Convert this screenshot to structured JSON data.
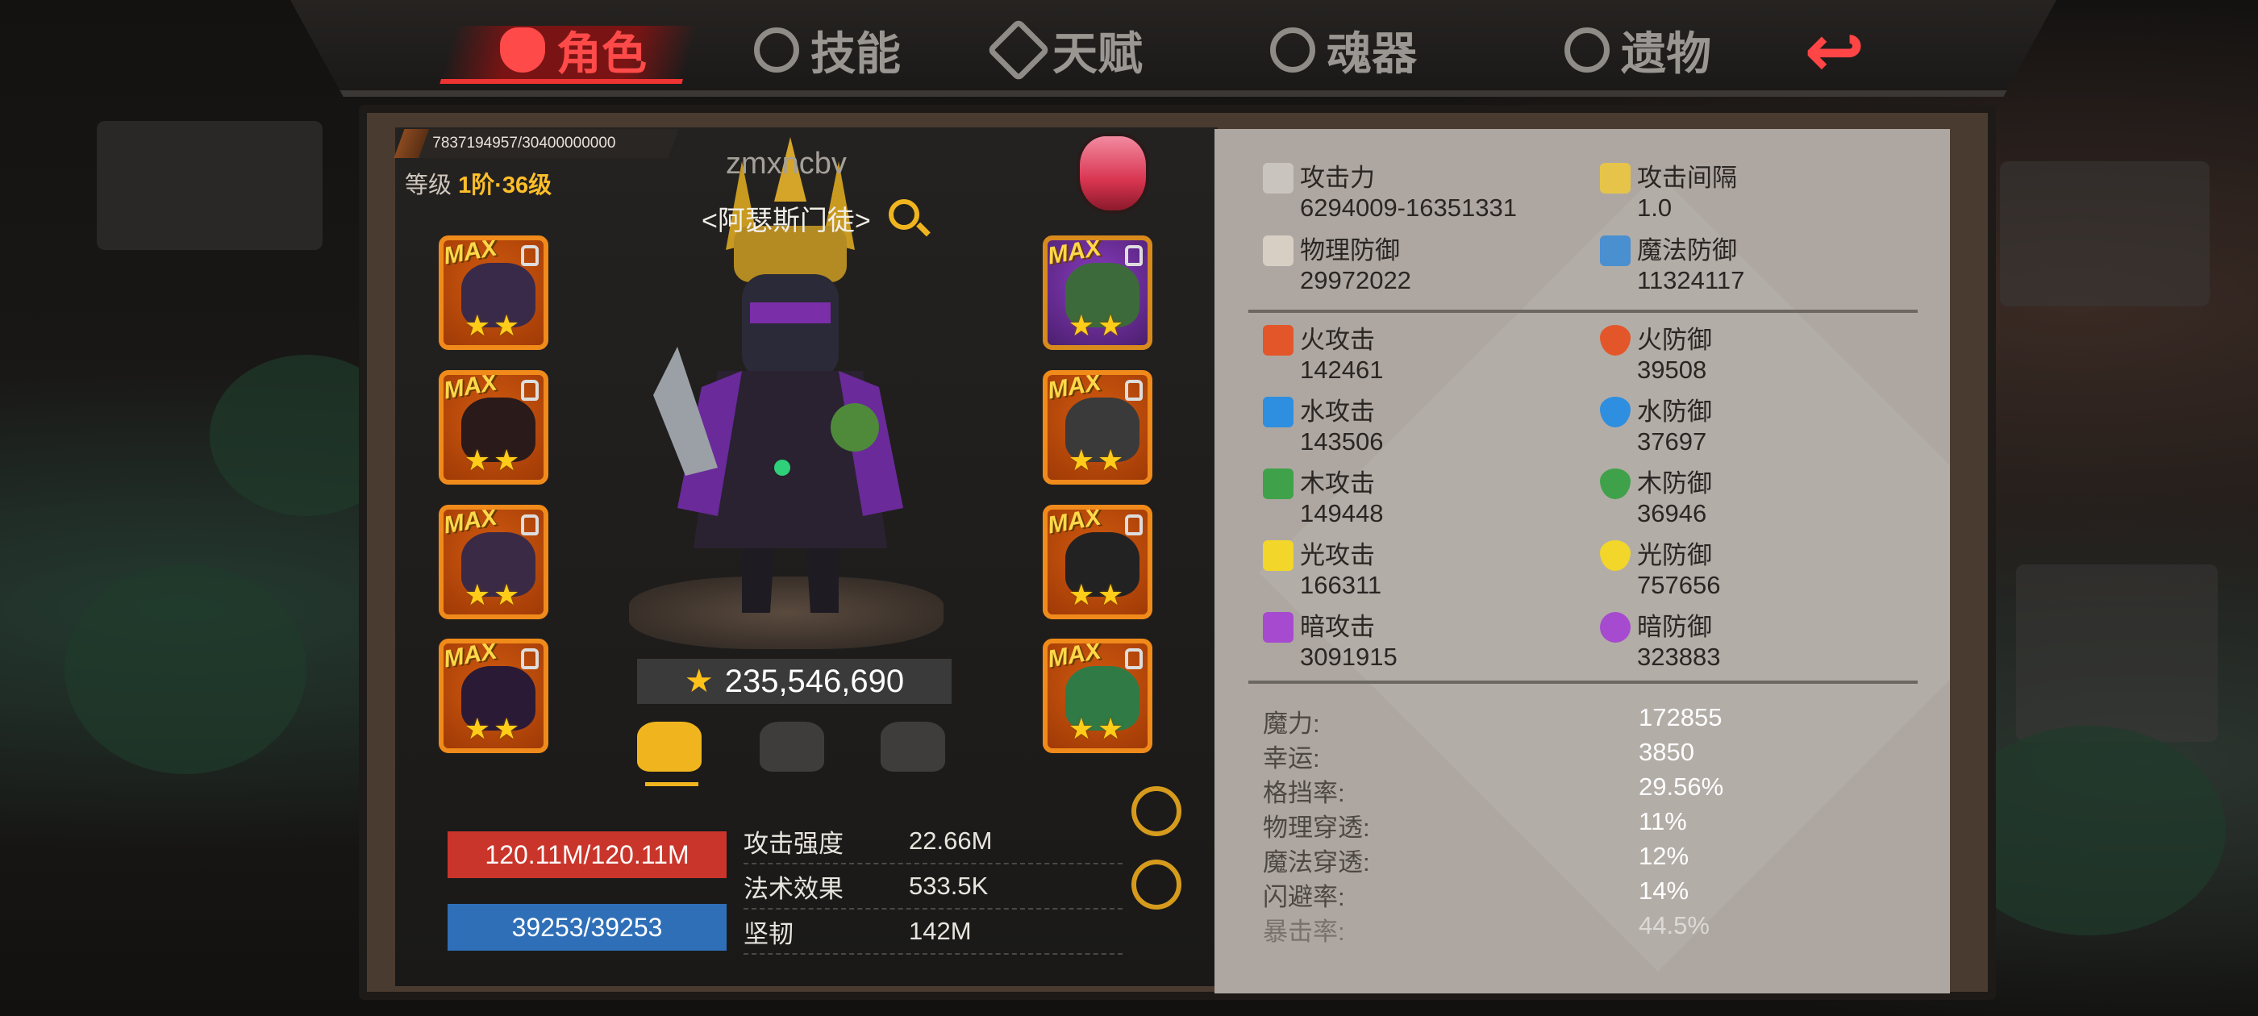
{
  "tabs": [
    {
      "label": "角色",
      "icon": "devil-icon",
      "active": true
    },
    {
      "label": "技能",
      "icon": "skill-icon",
      "active": false
    },
    {
      "label": "天赋",
      "icon": "talent-icon",
      "active": false
    },
    {
      "label": "魂器",
      "icon": "soul-icon",
      "active": false
    },
    {
      "label": "遗物",
      "icon": "relic-icon",
      "active": false
    }
  ],
  "hero": {
    "exp_text": "7837194957/30400000000",
    "exp_fraction": 0.258,
    "level_label": "等级",
    "level_value": "1阶·36级",
    "name": "zmxncbv",
    "title": "<阿瑟斯门徒>",
    "power": "235,546,690"
  },
  "gear_left": [
    {
      "max": "MAX",
      "stars": "★★",
      "color": "#3a2a4a"
    },
    {
      "max": "MAX",
      "stars": "★★",
      "color": "#2a1a1a"
    },
    {
      "max": "MAX",
      "stars": "★★",
      "color": "#3b2a45"
    },
    {
      "max": "MAX",
      "stars": "★★",
      "color": "#2a1a35"
    }
  ],
  "gear_right": [
    {
      "max": "MAX",
      "stars": "★★",
      "color": "#3d6a3a"
    },
    {
      "max": "MAX",
      "stars": "★★",
      "color": "#3a3a3a"
    },
    {
      "max": "MAX",
      "stars": "★★",
      "color": "#222222"
    },
    {
      "max": "MAX",
      "stars": "★★",
      "color": "#2f7a45"
    }
  ],
  "vitals": {
    "hp": "120.11M/120.11M",
    "mp": "39253/39253"
  },
  "sub_stats": [
    {
      "label": "攻击强度",
      "value": "22.66M"
    },
    {
      "label": "法术效果",
      "value": "533.5K"
    },
    {
      "label": "坚韧",
      "value": "142M"
    }
  ],
  "attributes": {
    "primary": [
      {
        "label": "攻击力",
        "value": "6294009-16351331",
        "icon": "sword-icon",
        "color": "#c9c4bd"
      },
      {
        "label": "攻击间隔",
        "value": "1.0",
        "icon": "sword-speed-icon",
        "color": "#e6c44a"
      },
      {
        "label": "物理防御",
        "value": "29972022",
        "icon": "sword-shield-icon",
        "color": "#d8cfc4"
      },
      {
        "label": "魔法防御",
        "value": "11324117",
        "icon": "magic-hammer-icon",
        "color": "#4a8fd0"
      }
    ],
    "elements": [
      {
        "atk_label": "火攻击",
        "atk_value": "142461",
        "def_label": "火防御",
        "def_value": "39508",
        "color": "#e3562a",
        "icon": "fire-icon"
      },
      {
        "atk_label": "水攻击",
        "atk_value": "143506",
        "def_label": "水防御",
        "def_value": "37697",
        "color": "#2e8ee0",
        "icon": "water-icon"
      },
      {
        "atk_label": "木攻击",
        "atk_value": "149448",
        "def_label": "木防御",
        "def_value": "36946",
        "color": "#3fa24a",
        "icon": "wood-icon"
      },
      {
        "atk_label": "光攻击",
        "atk_value": "166311",
        "def_label": "光防御",
        "def_value": "757656",
        "color": "#f2d62a",
        "icon": "light-icon"
      },
      {
        "atk_label": "暗攻击",
        "atk_value": "3091915",
        "def_label": "暗防御",
        "def_value": "323883",
        "color": "#a64ad0",
        "icon": "dark-icon"
      }
    ],
    "misc": [
      {
        "label": "魔力:",
        "value": "172855"
      },
      {
        "label": "幸运:",
        "value": "3850"
      },
      {
        "label": "格挡率:",
        "value": "29.56%"
      },
      {
        "label": "物理穿透:",
        "value": "11%"
      },
      {
        "label": "魔法穿透:",
        "value": "12%"
      },
      {
        "label": "闪避率:",
        "value": "14%"
      },
      {
        "label": "暴击率:",
        "value": "44.5%"
      }
    ]
  }
}
